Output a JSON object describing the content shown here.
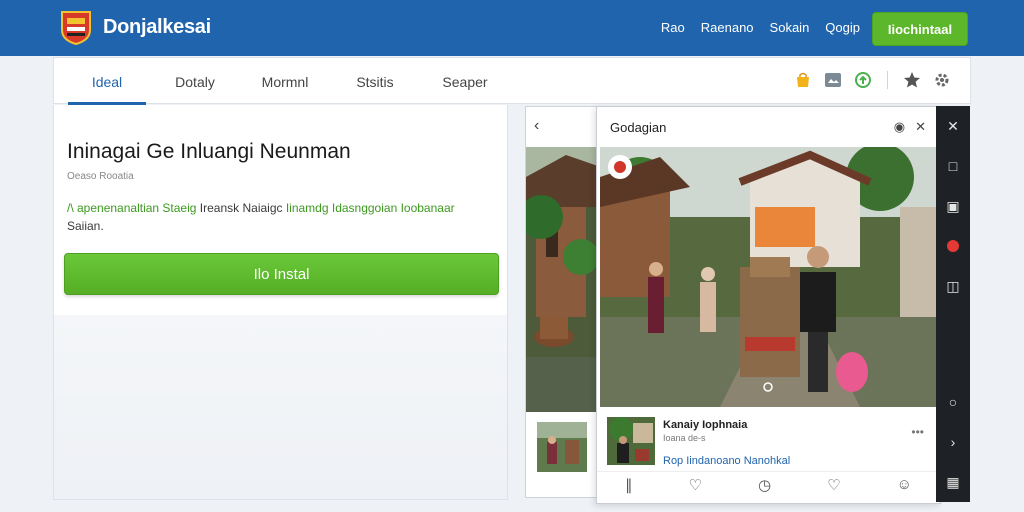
{
  "header": {
    "brand": "Donjalkesai",
    "nav": [
      "Rao",
      "Raenano",
      "Sokain",
      "Qogip"
    ],
    "install_label": "Iiochintaal"
  },
  "tabs": [
    {
      "label": "Ideal",
      "active": true
    },
    {
      "label": "Dotaly"
    },
    {
      "label": "Mormnl"
    },
    {
      "label": "Stsitis"
    },
    {
      "label": "Seaper"
    }
  ],
  "toolbar_icons": [
    "bag-icon",
    "image-icon",
    "share-icon",
    "star-icon",
    "gear-icon"
  ],
  "main": {
    "title": "Ininagai Ge Inluangi Neunman",
    "meta": "Oeaso Rooatia",
    "desc_accent": "/\\ apenenanaltian Staeig",
    "desc_main": " Ireansk Naiaigc ",
    "desc_accent2": "Iinamdg Idasnggoian Ioobanaar",
    "desc_tail": "Saiian.",
    "install_button": "Ilo Instal"
  },
  "preview": {
    "title": "Godagian",
    "item_name": "Kanaiy Iophnaia",
    "item_sub": "Ioana de-s",
    "item_dots": "•••",
    "item_link": "Rop Iindanoano Nanohkal"
  },
  "colors": {
    "header": "#1f64ad",
    "accent_green": "#5cb82a",
    "sidebar": "#1e2125",
    "record": "#e53935"
  }
}
